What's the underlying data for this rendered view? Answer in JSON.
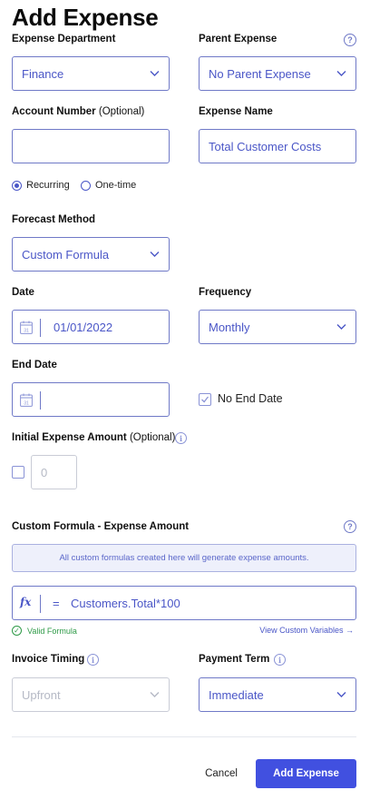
{
  "title": "Add Expense",
  "department": {
    "label": "Expense Department",
    "value": "Finance"
  },
  "parent": {
    "label": "Parent Expense",
    "value": "No Parent Expense"
  },
  "account": {
    "label": "Account Number",
    "optional": "(Optional)",
    "value": ""
  },
  "expense_name": {
    "label": "Expense Name",
    "value": "Total Customer Costs"
  },
  "recurrence": {
    "options": [
      "Recurring",
      "One-time"
    ],
    "selected": "Recurring"
  },
  "forecast": {
    "label": "Forecast Method",
    "value": "Custom Formula"
  },
  "date": {
    "label": "Date",
    "value": "01/01/2022",
    "calendar_day": "31"
  },
  "frequency": {
    "label": "Frequency",
    "value": "Monthly"
  },
  "end_date": {
    "label": "End Date",
    "value": "",
    "calendar_day": "31"
  },
  "no_end_date": {
    "label": "No End Date",
    "checked": true
  },
  "initial_amount": {
    "label": "Initial Expense Amount",
    "optional": "(Optional)",
    "placeholder": "0",
    "checked": false
  },
  "formula": {
    "label": "Custom Formula - Expense Amount",
    "note": "All custom formulas created here will generate expense amounts.",
    "fx": "fx",
    "equals": "=",
    "value": "Customers.Total*100",
    "valid_text": "Valid Formula",
    "variables_link": "View Custom Variables →"
  },
  "invoice_timing": {
    "label": "Invoice Timing",
    "value": "Upfront"
  },
  "payment_term": {
    "label": "Payment Term",
    "value": "Immediate"
  },
  "actions": {
    "cancel": "Cancel",
    "submit": "Add Expense"
  },
  "colors": {
    "accent": "#4150e0",
    "field_border": "#6f79c7",
    "valid": "#2e9a47"
  },
  "icons": [
    "help-circle-icon",
    "info-icon",
    "chevron-down-icon",
    "calendar-icon",
    "check-icon",
    "function-icon"
  ]
}
